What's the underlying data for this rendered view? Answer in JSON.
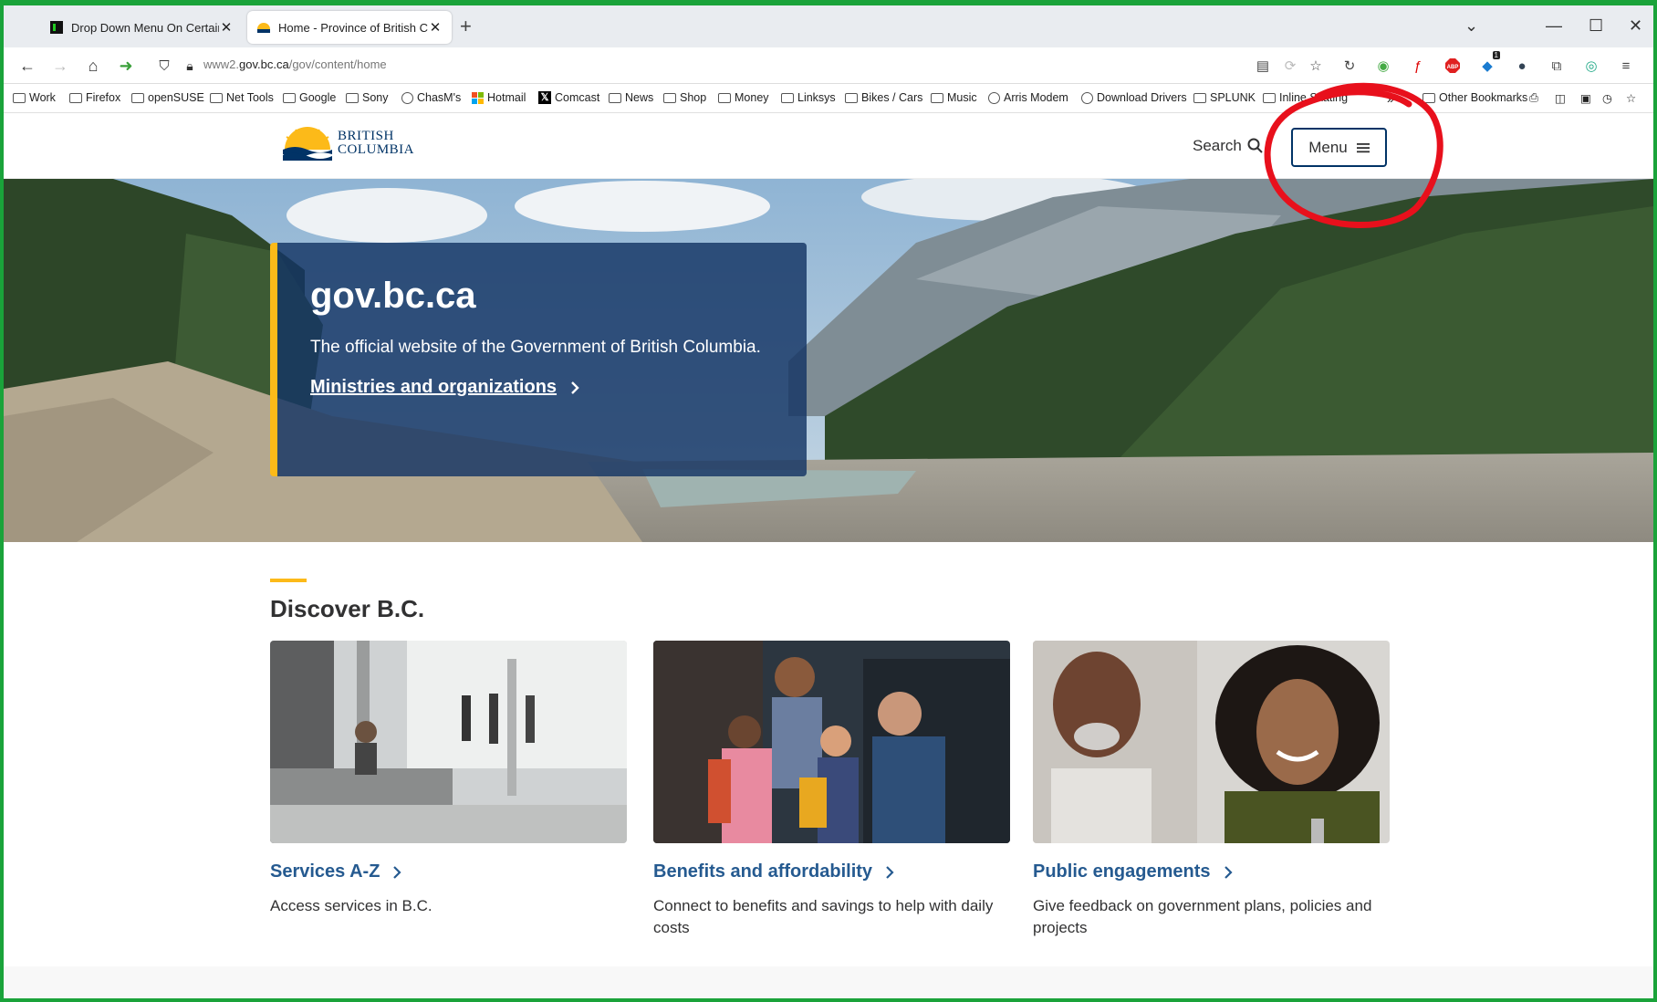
{
  "browser": {
    "tabs": [
      {
        "title": "Drop Down Menu On Certain W",
        "active": false
      },
      {
        "title": "Home - Province of British Colu",
        "active": true
      }
    ],
    "url_prefix": "www2.",
    "url_domain": "gov.bc.ca",
    "url_path": "/gov/content/home",
    "bookmarks": [
      {
        "label": "Work",
        "icon": "folder-icon"
      },
      {
        "label": "Firefox",
        "icon": "folder-icon"
      },
      {
        "label": "openSUSE",
        "icon": "folder-icon"
      },
      {
        "label": "Net Tools",
        "icon": "folder-icon"
      },
      {
        "label": "Google",
        "icon": "folder-icon"
      },
      {
        "label": "Sony",
        "icon": "folder-icon"
      },
      {
        "label": "ChasM's",
        "icon": "globe-icon"
      },
      {
        "label": "Hotmail",
        "icon": "microsoft-icon"
      },
      {
        "label": "Comcast",
        "icon": "x-icon"
      },
      {
        "label": "News",
        "icon": "folder-icon"
      },
      {
        "label": "Shop",
        "icon": "folder-icon"
      },
      {
        "label": "Money",
        "icon": "folder-icon"
      },
      {
        "label": "Linksys",
        "icon": "folder-icon"
      },
      {
        "label": "Bikes / Cars",
        "icon": "folder-icon"
      },
      {
        "label": "Music",
        "icon": "folder-icon"
      },
      {
        "label": "Arris Modem",
        "icon": "globe-icon"
      },
      {
        "label": "Download Drivers",
        "icon": "globe-icon"
      },
      {
        "label": "SPLUNK",
        "icon": "folder-icon"
      },
      {
        "label": "Inline Skating",
        "icon": "folder-icon"
      }
    ],
    "other_bookmarks": "Other Bookmarks",
    "extension_badge": "1"
  },
  "site": {
    "logo_line1": "BRITISH",
    "logo_line2": "COLUMBIA",
    "search_label": "Search",
    "menu_label": "Menu",
    "hero": {
      "title": "gov.bc.ca",
      "subtitle": "The official website of the Government of British Columbia.",
      "link": "Ministries and organizations"
    },
    "discover_title": "Discover B.C.",
    "cards": [
      {
        "title": "Services A-Z",
        "desc": "Access services in B.C."
      },
      {
        "title": "Benefits and affordability",
        "desc": "Connect to benefits and savings to help with daily costs"
      },
      {
        "title": "Public engagements",
        "desc": "Give feedback on government plans, policies and projects"
      }
    ]
  },
  "colors": {
    "bc_blue": "#013366",
    "bc_gold": "#fcba19",
    "link_blue": "#255a90",
    "annotation_red": "#e8101c"
  }
}
